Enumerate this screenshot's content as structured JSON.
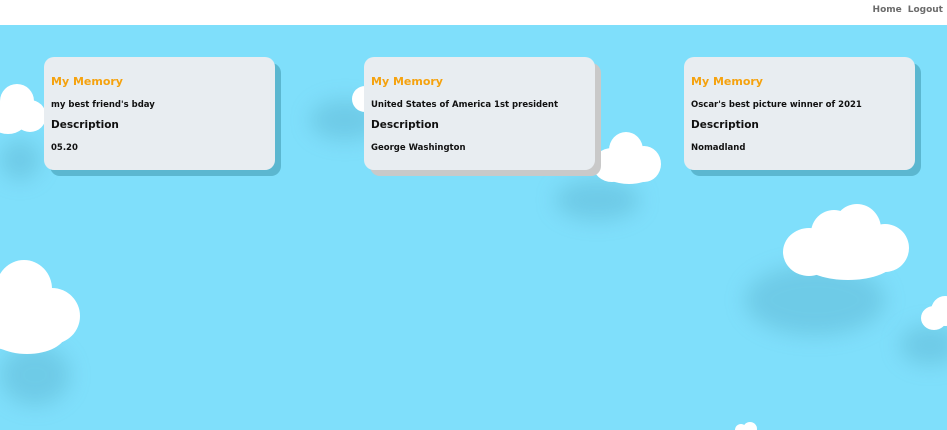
{
  "nav": {
    "home_label": "Home",
    "logout_label": "Logout"
  },
  "colors": {
    "sky": "#7fdffb",
    "card_background": "#e8edf1",
    "card_title": "#f5a20e",
    "card_shadow": "#5bb7d0"
  },
  "cards": [
    {
      "title": "My Memory",
      "memory": "my best friend's bday",
      "description_heading": "Description",
      "description": "05.20"
    },
    {
      "title": "My Memory",
      "memory": "United States of America 1st president",
      "description_heading": "Description",
      "description": "George Washington"
    },
    {
      "title": "My Memory",
      "memory": "Oscar's best picture winner of 2021",
      "description_heading": "Description",
      "description": "Nomadland"
    }
  ]
}
